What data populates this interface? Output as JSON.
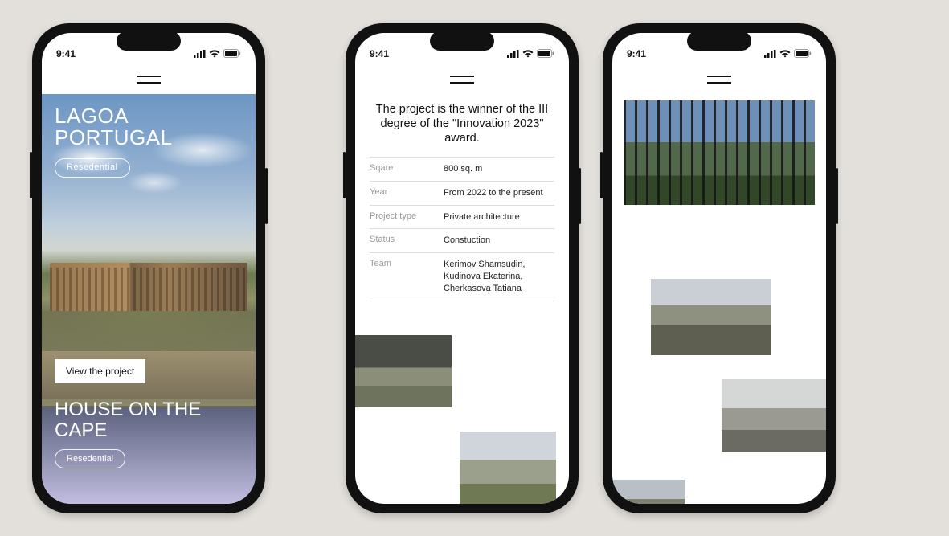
{
  "status": {
    "time": "9:41"
  },
  "phone1": {
    "project_a": {
      "line1": "LAGOA",
      "line2": "PORTUGAL",
      "category": "Resedential",
      "cta": "View the project"
    },
    "project_b": {
      "line1": "HOUSE ON THE",
      "line2": "CAPE",
      "category": "Resedential"
    }
  },
  "phone2": {
    "headline": "The project is the winner of the III degree of the \"Innovation 2023\" award.",
    "specs": [
      {
        "label": "Sqare",
        "value": "800 sq. m"
      },
      {
        "label": "Year",
        "value": "From 2022 to the present"
      },
      {
        "label": "Project type",
        "value": "Private architecture"
      },
      {
        "label": "Status",
        "value": "Constuction"
      },
      {
        "label": "Team",
        "value": "Kerimov Shamsudin, Kudinova Ekaterina, Cherkasova Tatiana"
      }
    ]
  }
}
